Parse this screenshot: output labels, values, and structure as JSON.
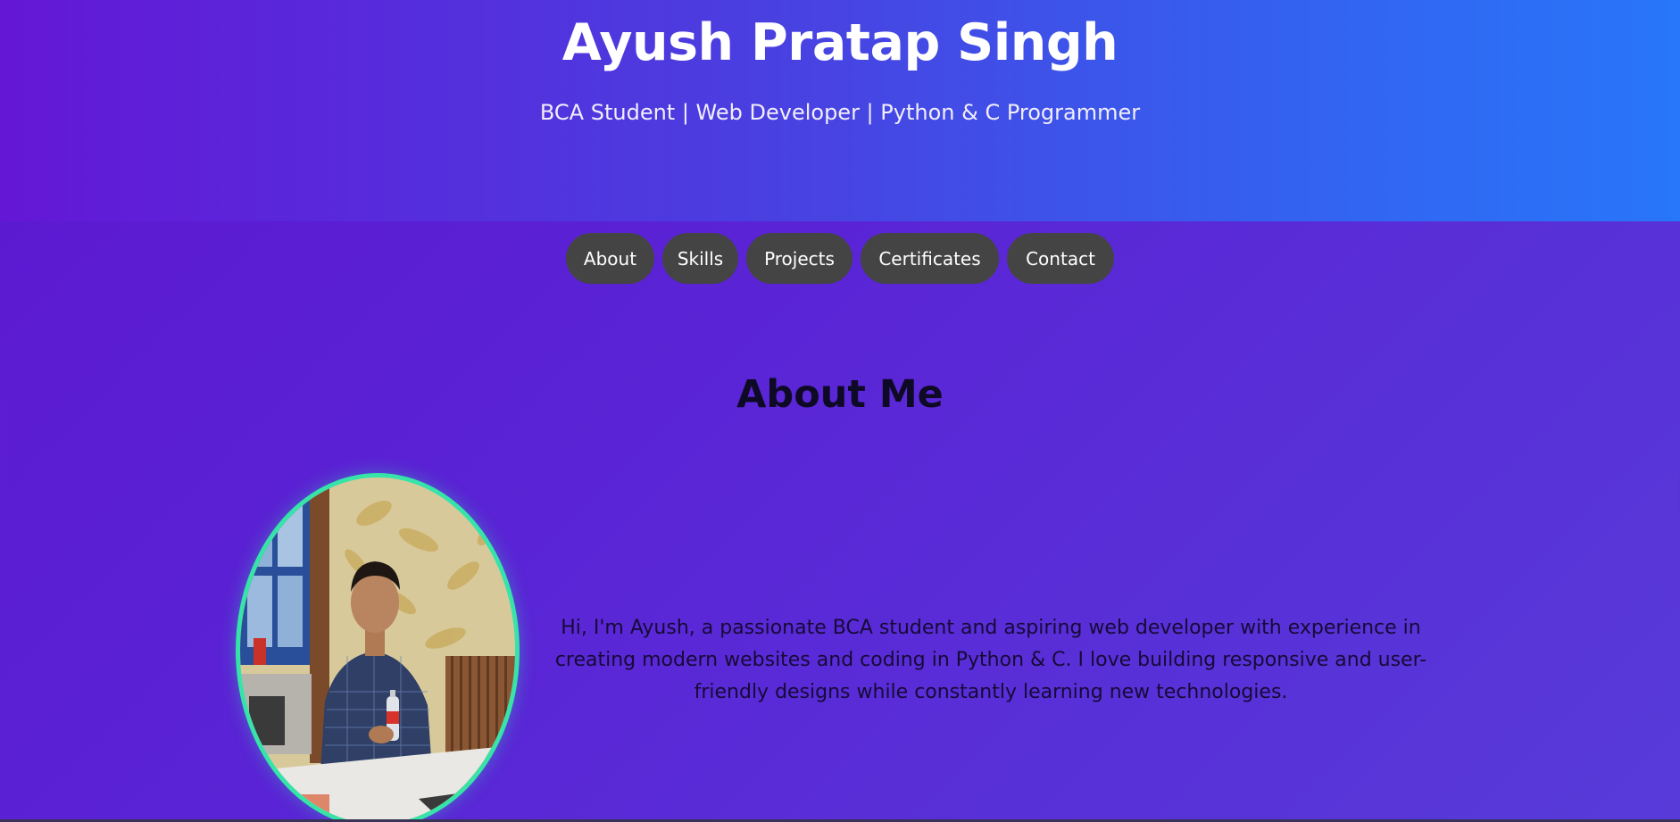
{
  "header": {
    "name": "Ayush Pratap Singh",
    "tagline": "BCA Student | Web Developer | Python & C Programmer"
  },
  "nav": {
    "items": [
      {
        "label": "About"
      },
      {
        "label": "Skills"
      },
      {
        "label": "Projects"
      },
      {
        "label": "Certificates"
      },
      {
        "label": "Contact"
      }
    ]
  },
  "about": {
    "title": "About Me",
    "text": "Hi, I'm Ayush, a passionate BCA student and aspiring web developer with experience in creating modern websites and coding in Python & C. I love building responsive and user-friendly designs while constantly learning new technologies."
  },
  "colors": {
    "hero_start": "#6417d6",
    "hero_end": "#2876f9",
    "nav_pill": "#444444",
    "avatar_border": "#36e3a8"
  }
}
